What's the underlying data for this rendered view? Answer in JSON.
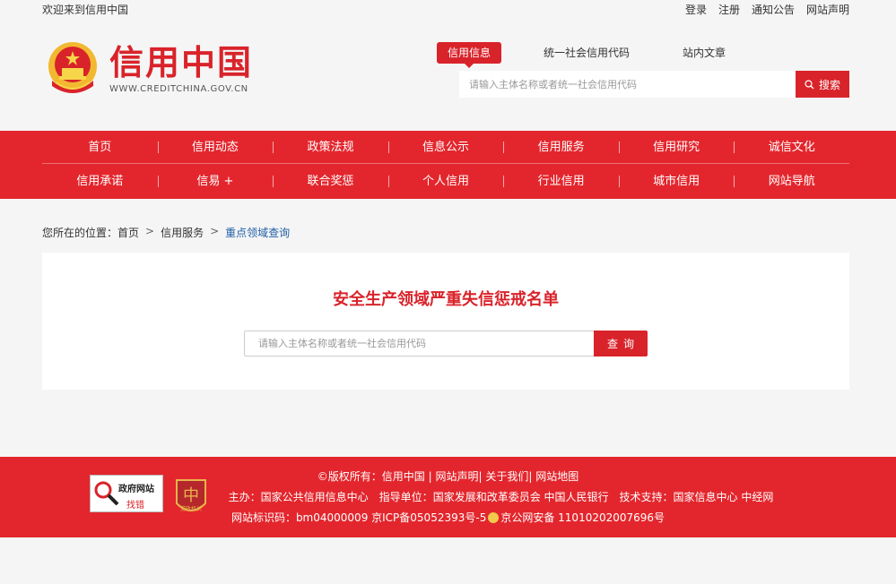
{
  "topbar": {
    "welcome": "欢迎来到信用中国",
    "links": [
      "登录",
      "注册",
      "通知公告",
      "网站声明"
    ]
  },
  "logo": {
    "title": "信用中国",
    "url": "WWW.CREDITCHINA.GOV.CN"
  },
  "search": {
    "tabs": [
      "信用信息",
      "统一社会信用代码",
      "站内文章"
    ],
    "placeholder": "请输入主体名称或者统一社会信用代码",
    "button": "搜索"
  },
  "nav": {
    "row1": [
      "首页",
      "信用动态",
      "政策法规",
      "信息公示",
      "信用服务",
      "信用研究",
      "诚信文化"
    ],
    "row2": [
      "信用承诺",
      "信易 +",
      "联合奖惩",
      "个人信用",
      "行业信用",
      "城市信用",
      "网站导航"
    ]
  },
  "breadcrumb": {
    "prefix": "您所在的位置：",
    "items": [
      "首页",
      "信用服务",
      "重点领域查询"
    ],
    "separator": ">"
  },
  "panel": {
    "title": "安全生产领域严重失信惩戒名单",
    "placeholder": "请输入主体名称或者统一社会信用代码",
    "button": "查询"
  },
  "footer": {
    "copyright_prefix": "©版权所有：",
    "copyright_links": [
      "信用中国",
      "网站声明",
      "关于我们",
      "网站地图"
    ],
    "host_label": "主办",
    "host": "：国家公共信用信息中心",
    "guide_label": "指导单位：",
    "guide": "国家发展和改革委员会 中国人民银行",
    "tech_label": "技术支持：",
    "tech": "国家信息中心 中经网",
    "site_id": "网站标识码：bm04000009 京ICP备05052393号-5",
    "police": "京公网安备 11010202007696号",
    "gov_badge_line1": "政府网站",
    "gov_badge_line2": "找错",
    "party_badge": "党政机关"
  },
  "colors": {
    "brand_red": "#e3262d",
    "link_blue": "#1f5fa6"
  }
}
